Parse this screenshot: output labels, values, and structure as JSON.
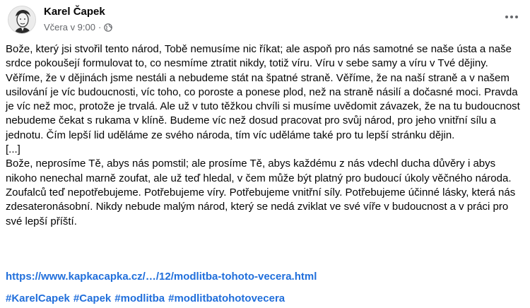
{
  "post": {
    "author": "Karel Čapek",
    "timestamp": "Včera v 9:00",
    "separator": "·",
    "privacy_icon": "globe-icon",
    "more_icon": "more-options-icon",
    "paragraphs": [
      "Bože, který jsi stvořil tento národ, Tobě nemusíme nic říkat; ale aspoň pro nás samotné se naše ústa a naše srdce pokoušejí formulovat to, co nesmíme ztratit nikdy, totiž víru. Víru v sebe samy a víru v Tvé dějiny. Věříme, že v dějinách jsme nestáli a nebudeme stát na špatné straně. Věříme, že na naší straně a v našem usilování je víc budoucnosti, víc toho, co poroste a ponese plod, než na straně násilí a dočasné moci. Pravda je víc než moc, protože je trvalá. Ale už v tuto těžkou chvíli si musíme uvědomit závazek, že na tu budoucnost nebudeme čekat s rukama v klíně. Budeme víc než dosud pracovat pro svůj národ, pro jeho vnitřní sílu a jednotu. Čím lepší lid uděláme ze svého národa, tím víc uděláme také pro tu lepší stránku dějin.",
      "[...]",
      "Bože, neprosíme Tě, abys nás pomstil; ale prosíme Tě, abys každému z nás vdechl ducha důvěry i abys nikoho nenechal marně zoufat, ale už teď hledal, v čem může být platný pro budoucí úkoly věčného národa. Zoufalců teď nepotřebujeme. Potřebujeme víry. Potřebujeme vnitřní síly. Potřebujeme účinné lásky, která nás zdesateronásobní. Nikdy nebude malým národ, který se nedá zviklat ve své víře v budoucnost a v práci pro své lepší příští."
    ],
    "link": "https://www.kapkacapka.cz/…/12/modlitba-tohoto-vecera.html",
    "hashtags": [
      "#KarelCapek",
      "#Capek",
      "#modlitba",
      "#modlitbatohotovecera"
    ]
  },
  "colors": {
    "link": "#216fdb",
    "text": "#050505",
    "secondary": "#65676b"
  }
}
